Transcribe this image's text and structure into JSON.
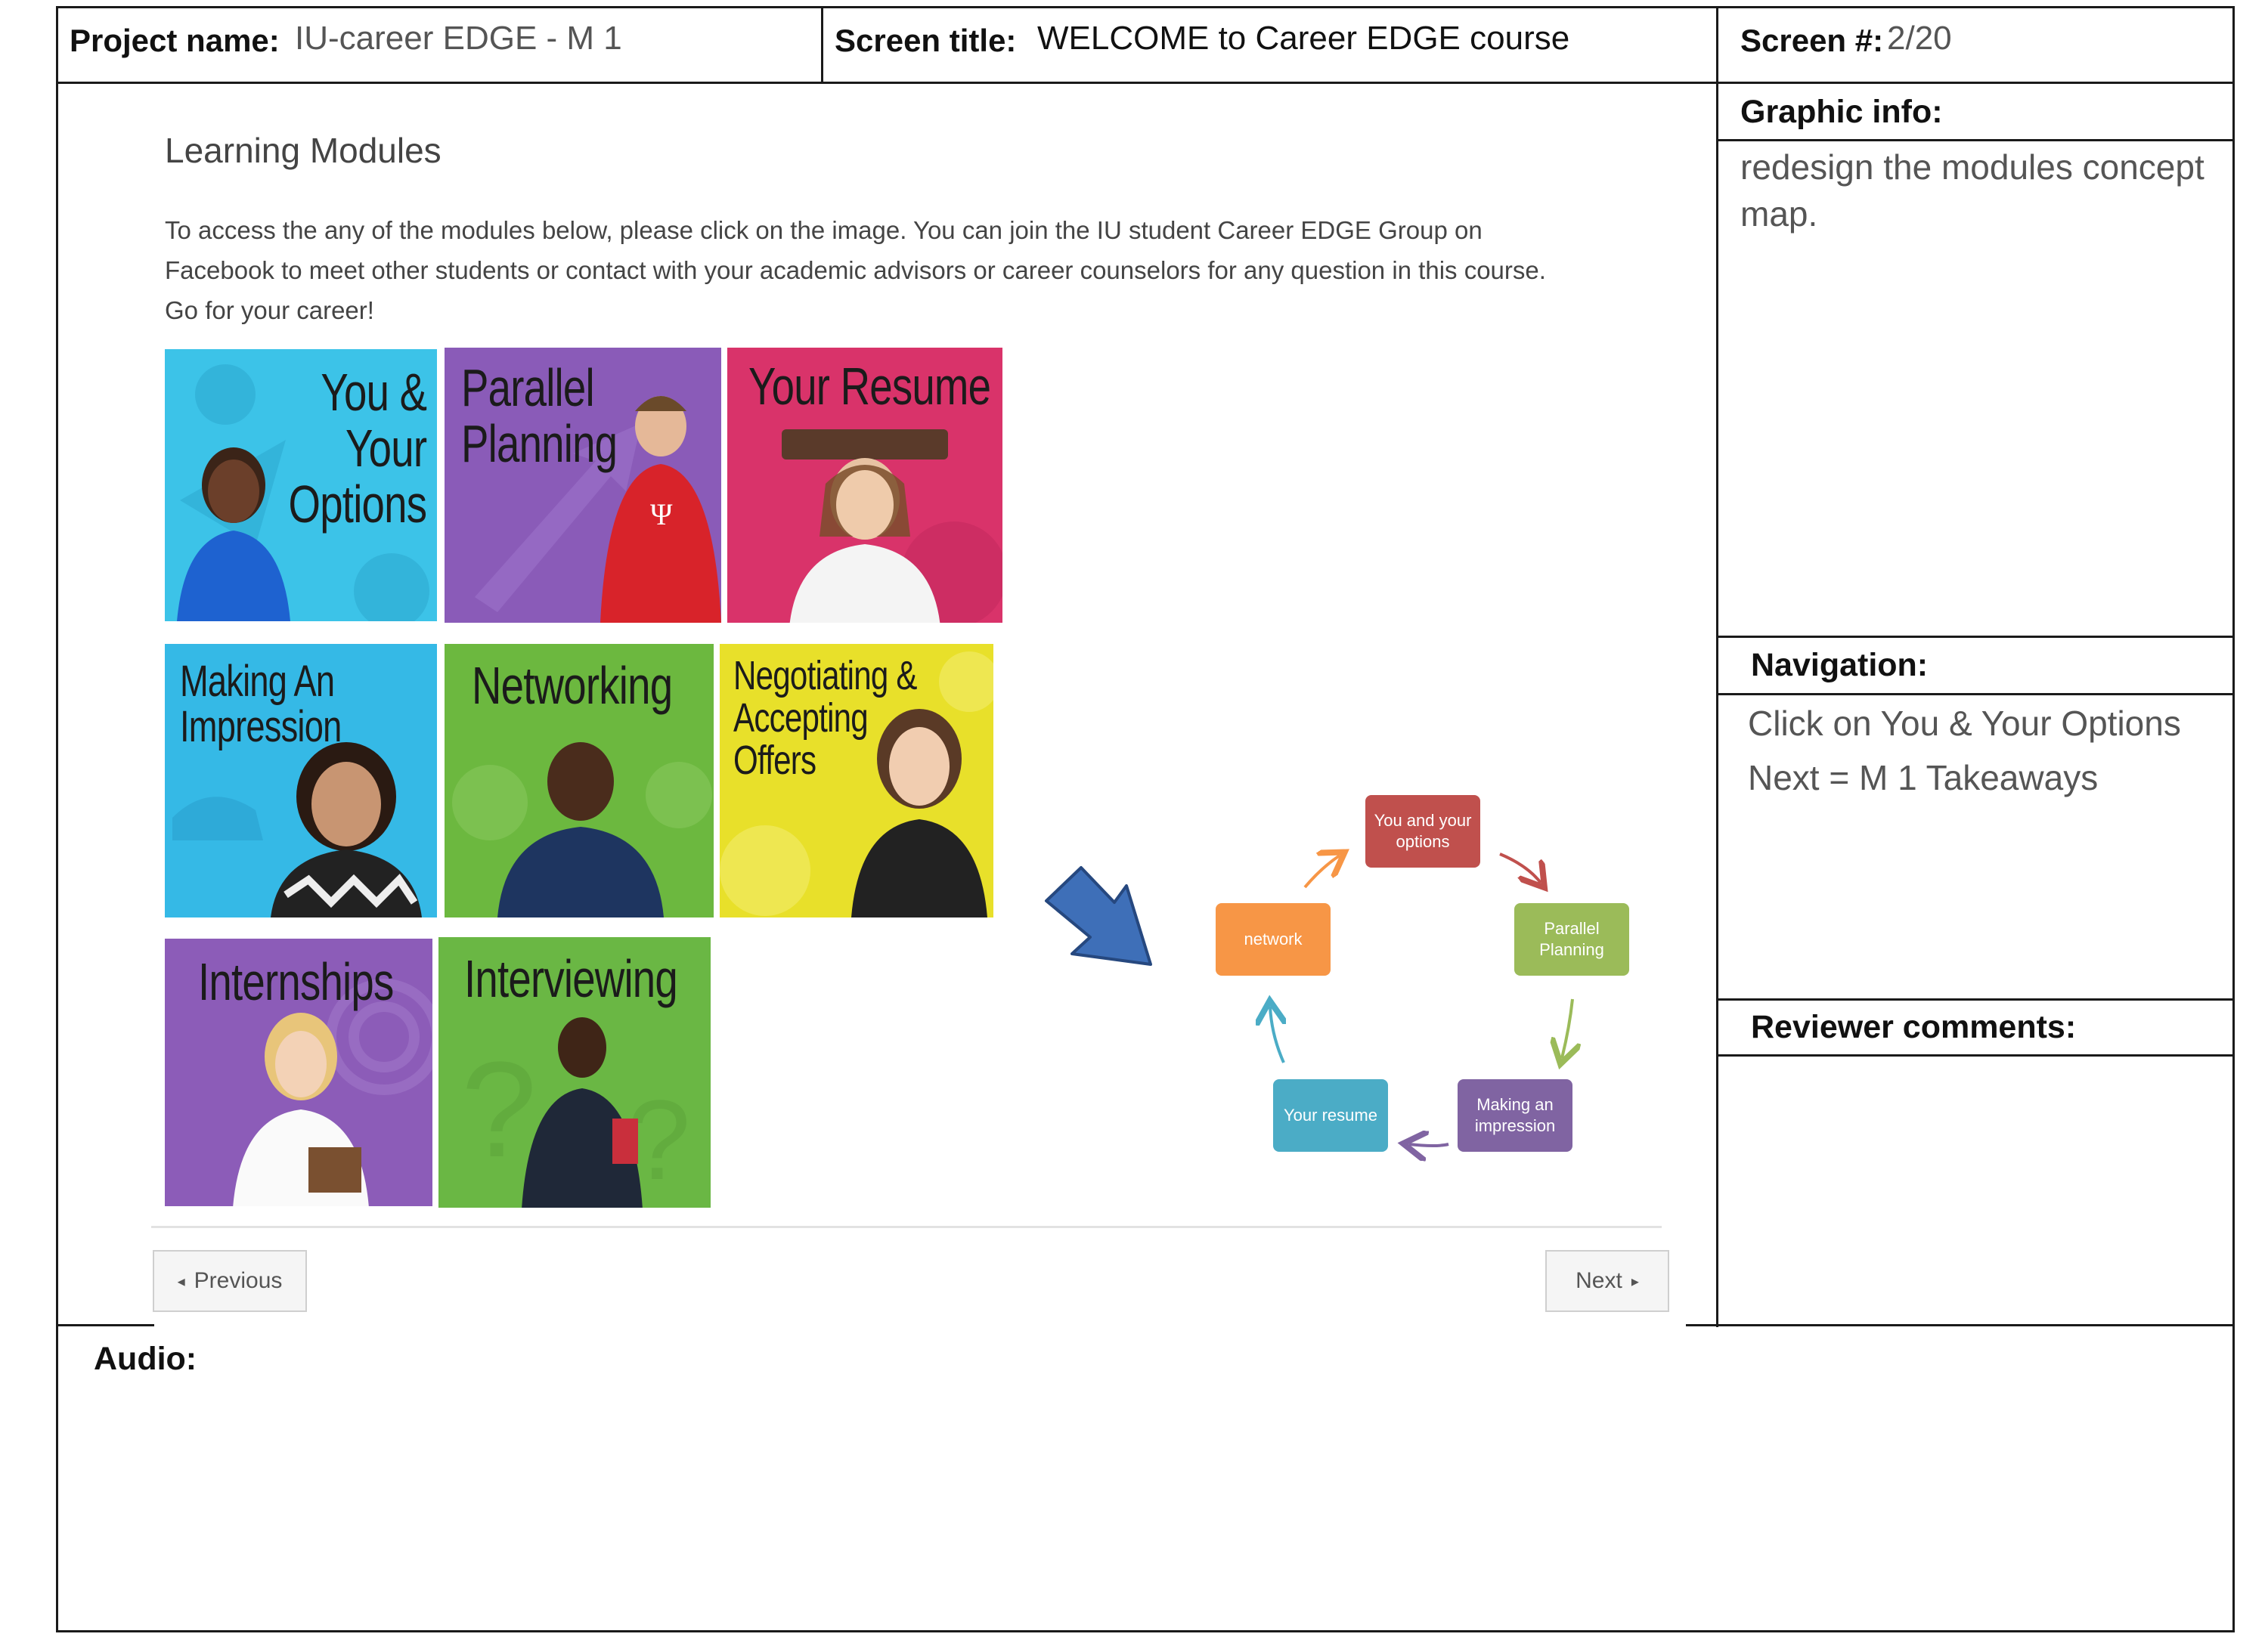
{
  "header": {
    "project_label": "Project name:",
    "project_value": "IU-career EDGE - M 1",
    "screen_title_label": "Screen title:",
    "screen_title_value": "WELCOME to Career EDGE course",
    "screen_num_label": "Screen #:",
    "screen_num_value": "2/20"
  },
  "sidebar": {
    "graphic_info_title": "Graphic info:",
    "graphic_info_text": "redesign the modules concept map.",
    "navigation_title": "Navigation:",
    "navigation_lines": [
      "Click on You & Your Options",
      "Next = M 1 Takeaways"
    ],
    "reviewer_title": "Reviewer comments:"
  },
  "audio": {
    "title": "Audio:"
  },
  "lms": {
    "heading": "Learning Modules",
    "intro_lines": [
      "To access the any of the modules below, please click on the image. You can join the IU student Career EDGE Group on",
      "Facebook to meet other students or contact with your academic advisors or career counselors for any question in this course.",
      "Go for your career!"
    ],
    "modules": [
      {
        "id": "you-your-options",
        "lines": [
          "You &",
          "Your",
          "Options"
        ],
        "color": "#3cc3e8"
      },
      {
        "id": "parallel-planning",
        "lines": [
          "Parallel",
          "Planning"
        ],
        "color": "#8a5bb8"
      },
      {
        "id": "your-resume",
        "lines": [
          "Your Resume"
        ],
        "color": "#d9336a"
      },
      {
        "id": "making-an-impression",
        "lines": [
          "Making An",
          "Impression"
        ],
        "color": "#35b9e6"
      },
      {
        "id": "networking",
        "lines": [
          "Networking"
        ],
        "color": "#6cb83f"
      },
      {
        "id": "negotiating-accepting-offers",
        "lines": [
          "Negotiating &",
          "Accepting",
          "Offers"
        ],
        "color": "#e8e02a"
      },
      {
        "id": "internships",
        "lines": [
          "Internships"
        ],
        "color": "#8c5cb8"
      },
      {
        "id": "interviewing",
        "lines": [
          "Interviewing"
        ],
        "color": "#6ab744"
      }
    ],
    "previous_label": "Previous",
    "next_label": "Next"
  },
  "concept_map": {
    "nodes": [
      {
        "id": "you-and-your-options",
        "label": "You and your options",
        "color": "#c0504d"
      },
      {
        "id": "parallel-planning",
        "label": "Parallel Planning",
        "color": "#9bbb59"
      },
      {
        "id": "making-an-impression",
        "label": "Making an impression",
        "color": "#8064a2"
      },
      {
        "id": "your-resume",
        "label": "Your resume",
        "color": "#4bacc6"
      },
      {
        "id": "network",
        "label": "network",
        "color": "#f79646"
      }
    ],
    "arrow_color": "#3e6fb8"
  }
}
